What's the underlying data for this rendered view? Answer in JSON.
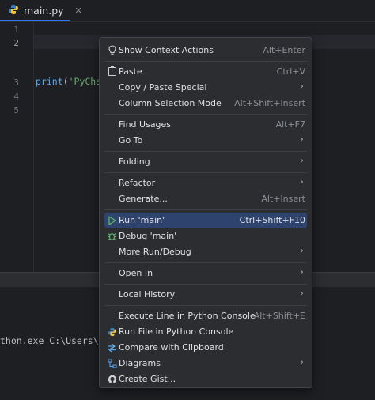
{
  "editor": {
    "tab": {
      "filename": "main.py",
      "close": "✕"
    },
    "line_numbers": [
      "1",
      "2",
      "3",
      "4",
      "5"
    ],
    "code": {
      "fn": "print",
      "open": "(",
      "str": "'PyChar"
    }
  },
  "console": {
    "text": "thon.exe C:\\Users\\Ki"
  },
  "menu": {
    "items": [
      {
        "label": "Show Context Actions",
        "shortcut": "Alt+Enter"
      },
      {
        "label": "Paste",
        "shortcut": "Ctrl+V"
      },
      {
        "label": "Copy / Paste Special",
        "arrow": "›"
      },
      {
        "label": "Column Selection Mode",
        "shortcut": "Alt+Shift+Insert"
      },
      {
        "label": "Find Usages",
        "shortcut": "Alt+F7"
      },
      {
        "label": "Go To",
        "arrow": "›"
      },
      {
        "label": "Folding",
        "arrow": "›"
      },
      {
        "label": "Refactor",
        "arrow": "›"
      },
      {
        "label": "Generate...",
        "shortcut": "Alt+Insert"
      },
      {
        "label": "Run 'main'",
        "shortcut": "Ctrl+Shift+F10"
      },
      {
        "label": "Debug 'main'"
      },
      {
        "label": "More Run/Debug",
        "arrow": "›"
      },
      {
        "label": "Open In",
        "arrow": "›"
      },
      {
        "label": "Local History",
        "arrow": "›"
      },
      {
        "label": "Execute Line in Python Console",
        "shortcut": "Alt+Shift+E"
      },
      {
        "label": "Run File in Python Console"
      },
      {
        "label": "Compare with Clipboard"
      },
      {
        "label": "Diagrams",
        "arrow": "›"
      },
      {
        "label": "Create Gist..."
      }
    ],
    "icons": {
      "show_context_actions": "lightbulb-icon",
      "paste": "clipboard-icon",
      "run": "play-icon",
      "debug": "bug-icon",
      "run_file_console": "python-icon",
      "compare": "compare-icon",
      "diagrams": "diagram-icon",
      "gist": "github-icon"
    }
  },
  "colors": {
    "background": "#1e1f22",
    "menu_bg": "#2b2d30",
    "selected": "#2e436e",
    "accent": "#3574f0",
    "run_green": "#5fb865"
  }
}
